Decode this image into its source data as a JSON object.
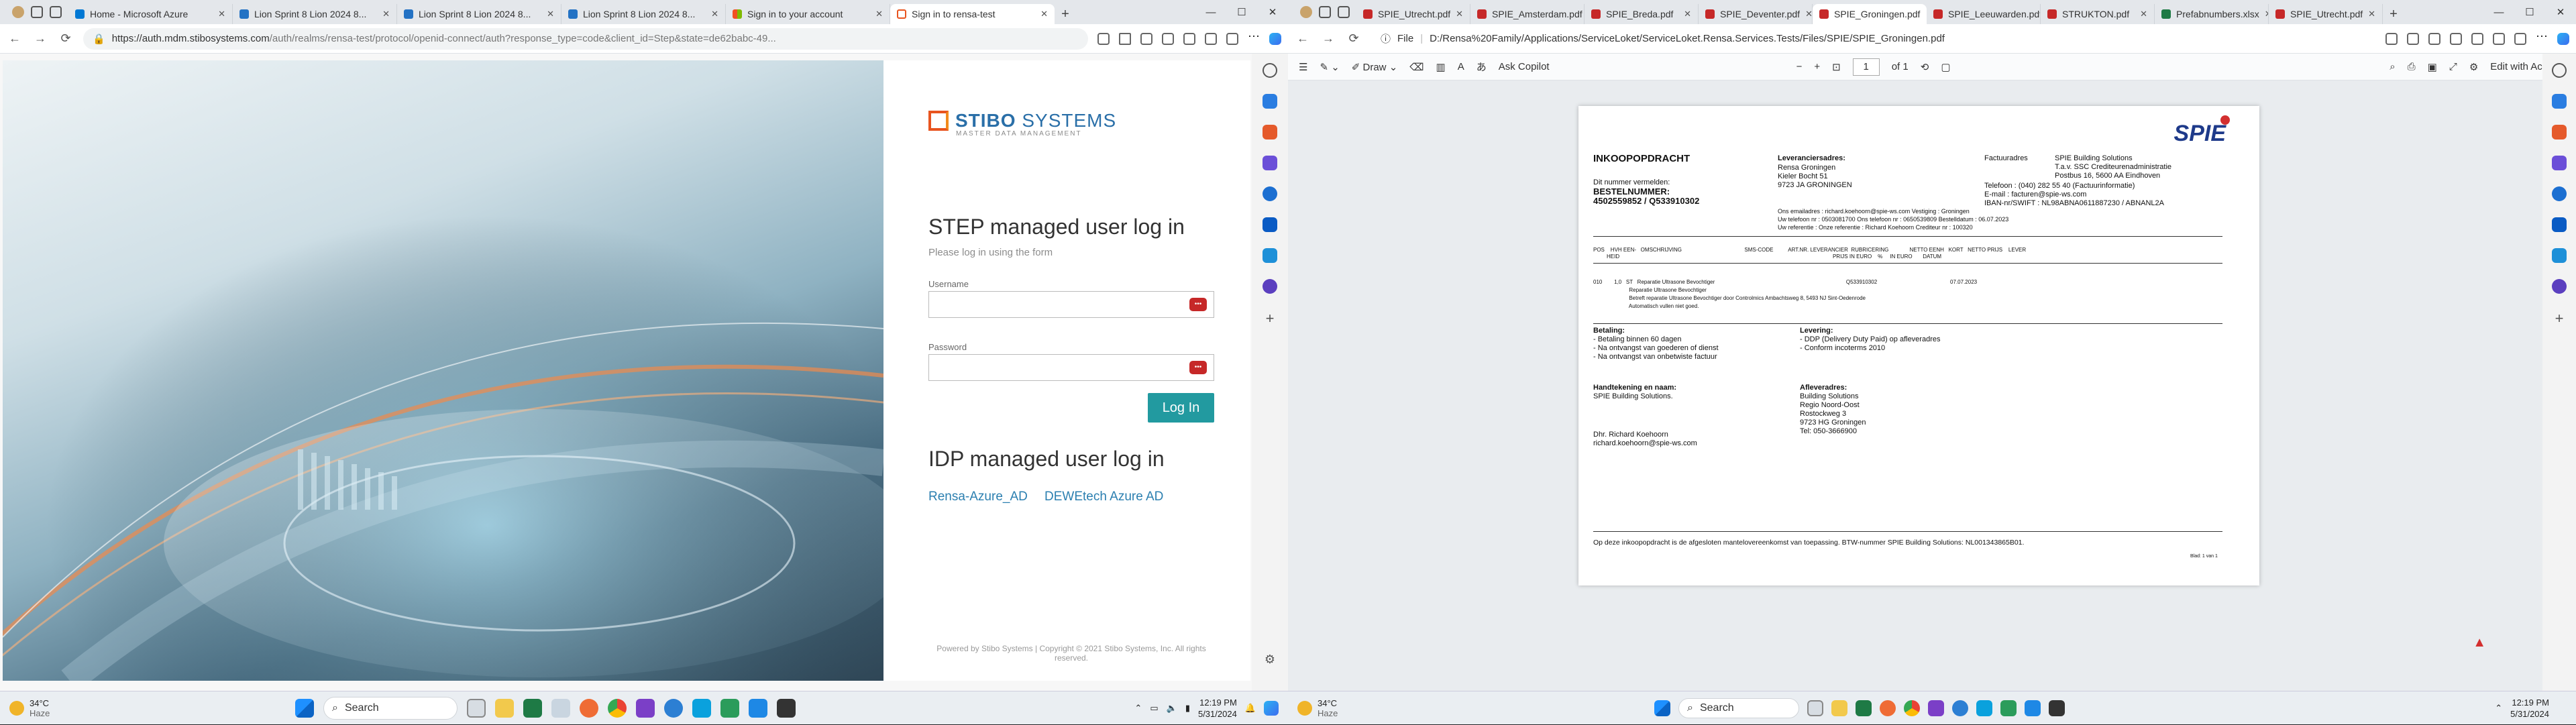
{
  "left": {
    "tabs": [
      {
        "label": "Home - Microsoft Azure",
        "color": "#0078d4",
        "active": false
      },
      {
        "label": "Lion Sprint 8 Lion 2024 8...",
        "color": "#0078d4",
        "active": false
      },
      {
        "label": "Lion Sprint 8 Lion 2024 8...",
        "color": "#0078d4",
        "active": false
      },
      {
        "label": "Lion Sprint 8 Lion 2024 8...",
        "color": "#0078d4",
        "active": false
      },
      {
        "label": "Sign in to your account",
        "color": "#f25022",
        "active": false
      },
      {
        "label": "Sign in to rensa-test",
        "color": "#e8541f",
        "active": true
      }
    ],
    "url_host": "https://auth.mdm.stibosystems.com",
    "url_rest": "/auth/realms/rensa-test/protocol/openid-connect/auth?response_type=code&client_id=Step&state=de62babc-49...",
    "login": {
      "logo_name_bold": "STIBO",
      "logo_name_light": " SYSTEMS",
      "logo_tagline": "MASTER DATA MANAGEMENT",
      "heading": "STEP managed user log in",
      "subheading": "Please log in using the form",
      "username_label": "Username",
      "password_label": "Password",
      "login_button": "Log In",
      "idp_heading": "IDP managed user log in",
      "idp_links": [
        "Rensa-Azure_AD",
        "DEWEtech Azure AD"
      ],
      "footer": "Powered by Stibo Systems | Copyright © 2021 Stibo Systems, Inc. All rights reserved."
    }
  },
  "right": {
    "tabs": [
      {
        "label": "SPIE_Utrecht.pdf",
        "active": false
      },
      {
        "label": "SPIE_Amsterdam.pdf",
        "active": false
      },
      {
        "label": "SPIE_Breda.pdf",
        "active": false
      },
      {
        "label": "SPIE_Deventer.pdf",
        "active": false
      },
      {
        "label": "SPIE_Groningen.pdf",
        "active": true
      },
      {
        "label": "SPIE_Leeuwarden.pdf",
        "active": false
      },
      {
        "label": "STRUKTON.pdf",
        "active": false
      },
      {
        "label": "Prefabnumbers.xlsx",
        "active": false
      },
      {
        "label": "SPIE_Utrecht.pdf",
        "active": false
      }
    ],
    "url_prefix": "File",
    "url": "D:/Rensa%20Family/Applications/ServiceLoket/ServiceLoket.Rensa.Services.Tests/Files/SPIE/SPIE_Groningen.pdf",
    "pdf_toolbar": {
      "draw": "Draw",
      "copilot": "Ask Copilot",
      "page": "1",
      "of": "of 1",
      "acrobat": "Edit with Acrobat"
    },
    "doc": {
      "title": "INKOOPOPDRACHT",
      "dit_nummer": "Dit nummer vermelden:",
      "bestel_label": "BESTELNUMMER:",
      "bestel_num": "4502559852 / Q533910302",
      "lev_label": "Leveranciersadres:",
      "lev_lines": [
        "Rensa Groningen",
        "Kieler Bocht 51",
        "9723 JA   GRONINGEN"
      ],
      "fact_label": "Factuuradres",
      "fact_lines": [
        "SPIE Building Solutions",
        "T.a.v. SSC Crediteurenadministratie",
        "Postbus 16, 5600 AA  Eindhoven"
      ],
      "tel": "Telefoon       : (040) 282 55 40  (Factuurinformatie)",
      "email": "E-mail          : facturen@spie-ws.com",
      "iban": "IBAN-nr/SWIFT  : NL98ABNA0611887230 / ABNANL2A",
      "contact1": "Uw telefoon nr  : 0503081700       Ons telefoon nr   : 0650539809                 Bestelldatum : 06.07.2023",
      "contact2": "Uw referentie    :                         Onze referentie   : Richard Koehoorn           Crediteur nr   : 100320",
      "contact0": "                                             Ons emailadres   : richard.koehoorn@spie-ws.com      Vestiging      : Groningen",
      "col_header": "POS    HVH EEN-   OMSCHRIJVING                                          SMS-CODE          ART.NR. LEVERANCIER  RUBRICERING              NETTO EENH   KORT   NETTO PRIJS    LEVER",
      "col_header2": "         HEID                                                                                                                                               PRIJS IN EURO    %     IN EURO       DATUM",
      "row1": "010        1,0   ST   Reparatie Ultrasone Bevochtiger                                                                                        Q533910302                                                 07.07.2023",
      "row2": "                        Reparatie Ultrasone Bevochtiger",
      "row3": "                        Betreft reparatie Ultrasone Bevochtiger door Controlmics Ambachtsweg 8, 5493 NJ Sint-Oedenrode",
      "row4": "                        Automatisch vullen niet goed.",
      "betaling_label": "Betaling:",
      "betaling": [
        "- Betaling binnen 60 dagen",
        "- Na ontvangst van goederen of dienst",
        "- Na ontvangst van onbetwiste factuur"
      ],
      "levering_label": "Levering:",
      "levering": [
        "- DDP (Delivery Duty Paid) op afleveradres",
        "- Conform incoterms 2010"
      ],
      "hand_label": "Handtekening en naam:",
      "hand_lines": [
        "SPIE Building Solutions."
      ],
      "dhr": "Dhr. Richard Koehoorn",
      "dhr_email": "richard.koehoorn@spie-ws.com",
      "aflever_label": "Afleveradres:",
      "aflever": [
        "Building Solutions",
        "Regio Noord-Oost",
        "Rostockweg 3",
        "9723 HG Groningen",
        "Tel: 050-3666900"
      ],
      "footer": "Op deze inkoopopdracht is de afgesloten mantelovereenkomst van toepassing.  BTW-nummer SPIE Building Solutions: NL001343865B01.",
      "page_footer": "Blad: 1 van 1",
      "logo": "SPIE"
    }
  },
  "taskbar_left": {
    "temp": "34°C",
    "cond": "Haze",
    "search": "Search",
    "time": "12:19 PM",
    "date": "5/31/2024"
  },
  "taskbar_right": {
    "temp": "34°C",
    "cond": "Haze",
    "search": "Search",
    "time": "12:19 PM",
    "date": "5/31/2024"
  }
}
